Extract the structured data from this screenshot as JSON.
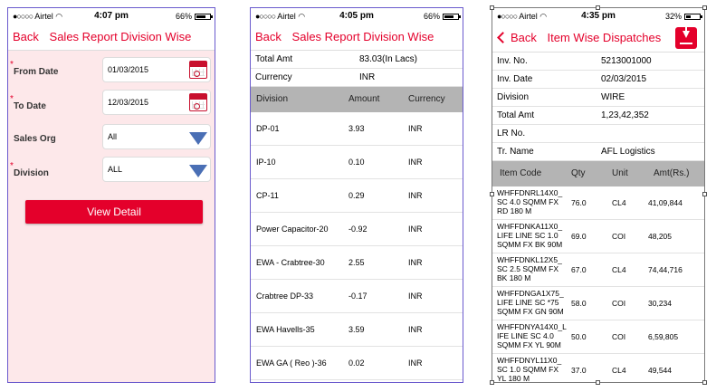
{
  "screen1": {
    "status": {
      "carrier": "Airtel",
      "time": "4:07 pm",
      "battery": "66%"
    },
    "nav": {
      "back": "Back",
      "title": "Sales Report Division Wise"
    },
    "fields": [
      {
        "label": "From Date",
        "value": "01/03/2015",
        "required": true
      },
      {
        "label": "To Date",
        "value": "12/03/2015",
        "required": true
      },
      {
        "label": "Sales Org",
        "value": "All",
        "required": false
      },
      {
        "label": "Division",
        "value": "ALL",
        "required": true
      }
    ],
    "view_button": "View Detail",
    "required_mark": "*",
    "signal_dots": "●○○○○"
  },
  "screen2": {
    "status": {
      "carrier": "Airtel",
      "time": "4:05 pm",
      "battery": "66%"
    },
    "nav": {
      "back": "Back",
      "title": "Sales Report Division Wise"
    },
    "summary": [
      {
        "key": "Total Amt",
        "value": "83.03(In Lacs)"
      },
      {
        "key": "Currency",
        "value": "INR"
      }
    ],
    "columns": [
      "Division",
      "Amount",
      "Currency"
    ],
    "rows": [
      [
        "DP-01",
        "3.93",
        "INR"
      ],
      [
        "IP-10",
        "0.10",
        "INR"
      ],
      [
        "CP-11",
        "0.29",
        "INR"
      ],
      [
        "Power Capacitor-20",
        "-0.92",
        "INR"
      ],
      [
        "EWA - Crabtree-30",
        "2.55",
        "INR"
      ],
      [
        "Crabtree DP-33",
        "-0.17",
        "INR"
      ],
      [
        "EWA Havells-35",
        "3.59",
        "INR"
      ],
      [
        "EWA GA ( Reo )-36",
        "0.02",
        "INR"
      ]
    ]
  },
  "screen3": {
    "status": {
      "carrier": "Airtel",
      "time": "4:35 pm",
      "battery": "32%"
    },
    "nav": {
      "back": "Back",
      "title": "Item Wise Dispatches"
    },
    "details": [
      {
        "key": "Inv. No.",
        "value": "5213001000"
      },
      {
        "key": "Inv. Date",
        "value": "02/03/2015"
      },
      {
        "key": "Division",
        "value": "WIRE"
      },
      {
        "key": "Total Amt",
        "value": "1,23,42,352"
      },
      {
        "key": "LR No.",
        "value": ""
      },
      {
        "key": "Tr. Name",
        "value": "AFL Logistics"
      }
    ],
    "columns": [
      "Item Code",
      "Qty",
      "Unit",
      "Amt(Rs.)"
    ],
    "rows": [
      [
        "WHFFDNRL14X0_ SC 4.0 SQMM FX RD 180 M",
        "76.0",
        "CL4",
        "41,09,844"
      ],
      [
        "WHFFDNKA11X0_ LIFE LINE SC 1.0 SQMM FX BK 90M",
        "69.0",
        "COI",
        "48,205"
      ],
      [
        "WHFFDNKL12X5_ SC 2.5 SQMM FX BK 180 M",
        "67.0",
        "CL4",
        "74,44,716"
      ],
      [
        "WHFFDNGA1X75_ LIFE LINE SC *75 SQMM FX GN 90M",
        "58.0",
        "COI",
        "30,234"
      ],
      [
        "WHFFDNYA14X0_L IFE LINE SC 4.0 SQMM FX YL 90M",
        "50.0",
        "COI",
        "6,59,805"
      ],
      [
        "WHFFDNYL11X0_ SC 1.0 SQMM FX YL 180 M",
        "37.0",
        "CL4",
        "49,544"
      ]
    ]
  },
  "colors": {
    "accent": "#e4002b",
    "header_gray": "#b4b4b4",
    "form_bg": "#fde8ea",
    "dropdown_blue": "#4a6fb5"
  }
}
